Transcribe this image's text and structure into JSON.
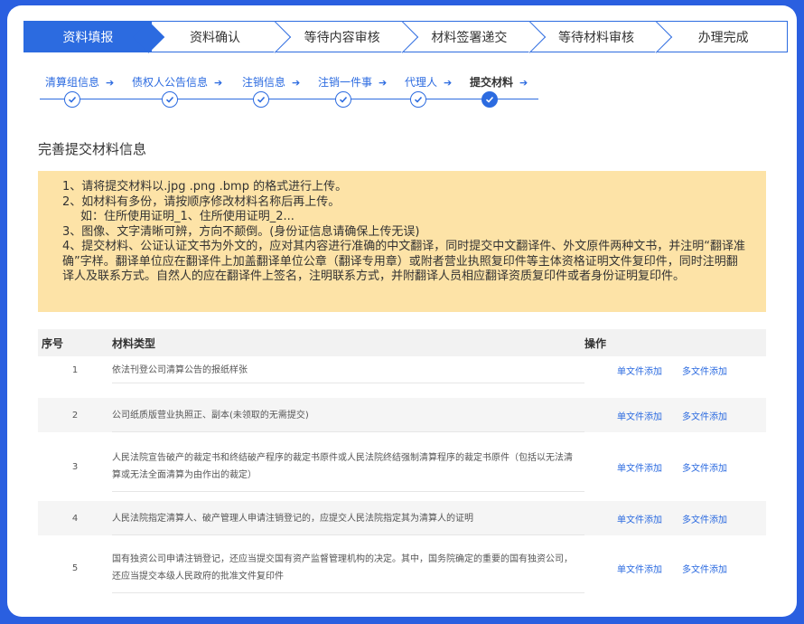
{
  "process_steps": [
    {
      "label": "资料填报",
      "active": true
    },
    {
      "label": "资料确认",
      "active": false
    },
    {
      "label": "等待内容审核",
      "active": false
    },
    {
      "label": "材料签署递交",
      "active": false
    },
    {
      "label": "等待材料审核",
      "active": false
    },
    {
      "label": "办理完成",
      "active": false
    }
  ],
  "sub_steps": [
    {
      "label": "清算组信息",
      "current": false
    },
    {
      "label": "债权人公告信息",
      "current": false
    },
    {
      "label": "注销信息",
      "current": false
    },
    {
      "label": "注销一件事",
      "current": false
    },
    {
      "label": "代理人",
      "current": false
    },
    {
      "label": "提交材料",
      "current": true
    }
  ],
  "section_title": "完善提交材料信息",
  "notice": {
    "line1": "1、请将提交材料以.jpg .png .bmp 的格式进行上传。",
    "line2": "2、如材料有多份，请按顺序修改材料名称后再上传。",
    "line3": "如：住所使用证明_1、住所使用证明_2...",
    "line4": "3、图像、文字清晰可辨，方向不颠倒。(身份证信息请确保上传无误)",
    "line5": "4、提交材料、公证认证文书为外文的，应对其内容进行准确的中文翻译，同时提交中文翻译件、外文原件两种文书，并注明“翻译准确”字样。翻译单位应在翻译件上加盖翻译单位公章（翻译专用章）或附者营业执照复印件等主体资格证明文件复印件，同时注明翻译人及联系方式。自然人的应在翻译件上签名，注明联系方式，并附翻译人员相应翻译资质复印件或者身份证明复印件。"
  },
  "table": {
    "headers": {
      "index": "序号",
      "type": "材料类型",
      "ops": "操作"
    },
    "single_upload": "单文件添加",
    "multi_upload": "多文件添加",
    "rows": [
      {
        "index": "1",
        "type": "依法刊登公司清算公告的报纸样张"
      },
      {
        "index": "2",
        "type": "公司纸质版营业执照正、副本(未领取的无需提交)"
      },
      {
        "index": "3",
        "type": "人民法院宣告破产的裁定书和终结破产程序的裁定书原件或人民法院终结强制清算程序的裁定书原件（包括以无法清算或无法全面清算为由作出的裁定）"
      },
      {
        "index": "4",
        "type": "人民法院指定清算人、破产管理人申请注销登记的，应提交人民法院指定其为清算人的证明"
      },
      {
        "index": "5",
        "type": "国有独资公司申请注销登记，还应当提交国有资产监督管理机构的决定。其中，国务院确定的重要的国有独资公司，还应当提交本级人民政府的批准文件复印件"
      }
    ]
  },
  "colors": {
    "accent": "#2c6be0",
    "notice_bg": "#fde3a7",
    "frame_bg": "#2a5fe0"
  }
}
